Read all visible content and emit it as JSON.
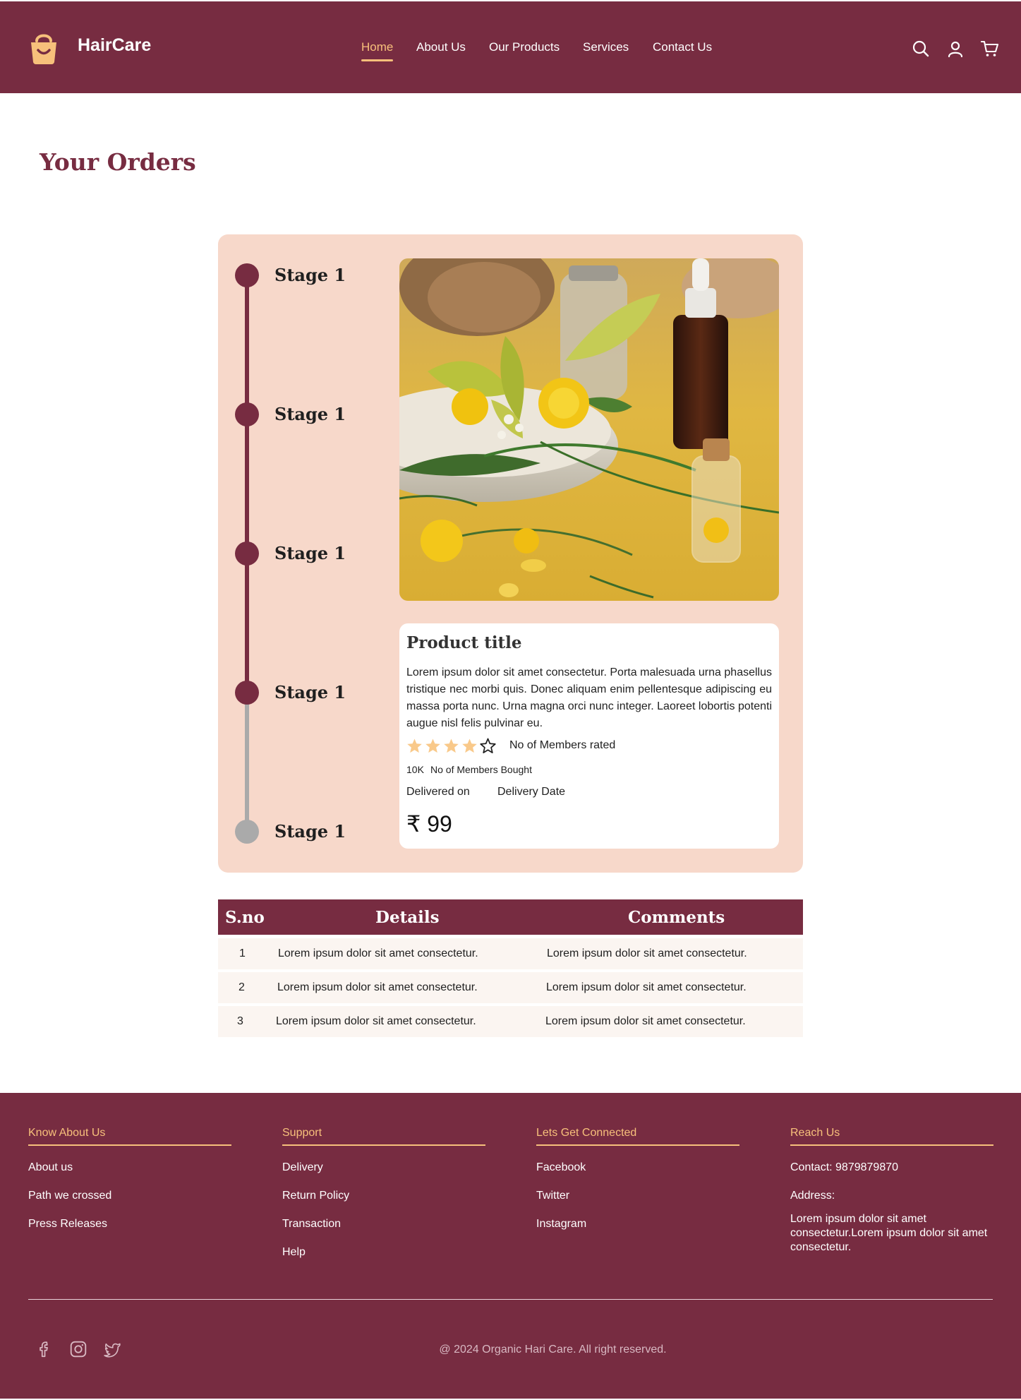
{
  "header": {
    "brand": "HairCare",
    "nav": [
      "Home",
      "About Us",
      "Our Products",
      "Services",
      "Contact Us"
    ],
    "active_nav": "Home",
    "icons": [
      "search-icon",
      "user-icon",
      "cart-icon"
    ]
  },
  "page": {
    "title": "Your Orders"
  },
  "order": {
    "stages": [
      {
        "label": "Stage 1",
        "completed": true
      },
      {
        "label": "Stage 1",
        "completed": true
      },
      {
        "label": "Stage 1",
        "completed": true
      },
      {
        "label": "Stage 1",
        "completed": true
      },
      {
        "label": "Stage 1",
        "completed": false
      }
    ],
    "product": {
      "title": "Product title",
      "description": "Lorem ipsum dolor sit amet consectetur. Porta malesuada urna phasellus tristique nec morbi quis. Donec aliquam enim pellentesque adipiscing eu massa porta nunc. Urna magna orci nunc integer. Laoreet lobortis potenti augue nisl felis pulvinar eu.",
      "rating": 4,
      "rating_max": 5,
      "rated_label": "No of Members rated",
      "bought_count": "10K",
      "bought_label": "No of Members Bought",
      "delivered_label": "Delivered on",
      "delivery_date": "Delivery Date",
      "price": "₹ 99"
    }
  },
  "table": {
    "headers": [
      "S.no",
      "Details",
      "Comments"
    ],
    "rows": [
      {
        "sno": "1",
        "details": "Lorem ipsum dolor sit amet consectetur.",
        "comments": "Lorem ipsum dolor sit amet consectetur."
      },
      {
        "sno": "2",
        "details": "Lorem ipsum dolor sit amet consectetur.",
        "comments": "Lorem ipsum dolor sit amet consectetur."
      },
      {
        "sno": "3",
        "details": "Lorem ipsum dolor sit amet consectetur.",
        "comments": "Lorem ipsum dolor sit amet consectetur."
      }
    ]
  },
  "footer": {
    "columns": [
      {
        "heading": "Know About Us",
        "links": [
          "About us",
          "Path we crossed",
          "Press Releases"
        ]
      },
      {
        "heading": "Support",
        "links": [
          "Delivery",
          "Return Policy",
          "Transaction",
          "Help"
        ]
      },
      {
        "heading": "Lets Get Connected",
        "links": [
          "Facebook",
          "Twitter",
          "Instagram"
        ]
      },
      {
        "heading": "Reach Us",
        "contact": "Contact: 9879879870",
        "address_label": "Address:",
        "address": "Lorem ipsum dolor sit amet consectetur.Lorem ipsum dolor sit amet consectetur."
      }
    ],
    "social_icons": [
      "facebook-icon",
      "instagram-icon",
      "twitter-icon"
    ],
    "copyright": "@ 2024 Organic Hari Care. All right reserved."
  },
  "colors": {
    "brand": "#772c41",
    "accent": "#f7c07b",
    "card_bg": "#f7d8ca",
    "inactive": "#aaaaaa"
  }
}
